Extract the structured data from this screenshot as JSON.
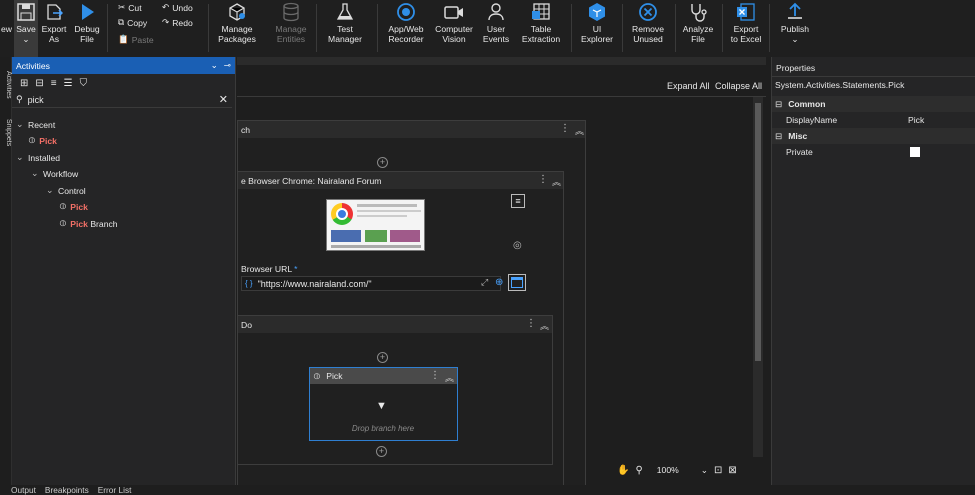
{
  "ribbon": {
    "new_label": "ew",
    "save_label": "Save",
    "export_as_label": "Export\nAs",
    "debug_file_label": "Debug\nFile",
    "cut_label": "Cut",
    "copy_label": "Copy",
    "paste_label": "Paste",
    "undo_label": "Undo",
    "redo_label": "Redo",
    "manage_packages_label": "Manage\nPackages",
    "manage_entities_label": "Manage\nEntities",
    "test_manager_label": "Test\nManager",
    "recorder_label": "App/Web\nRecorder",
    "computer_vision_label": "Computer\nVision",
    "user_events_label": "User\nEvents",
    "table_extraction_label": "Table\nExtraction",
    "ui_explorer_label": "UI\nExplorer",
    "remove_unused_label": "Remove\nUnused",
    "analyze_file_label": "Analyze\nFile",
    "export_excel_label": "Export\nto Excel",
    "publish_label": "Publish"
  },
  "left_strip": {
    "tab1": "Activities",
    "tab2": "Snippets"
  },
  "activities": {
    "title": "Activities",
    "search_value": "pick",
    "tree": {
      "recent": "Recent",
      "recent_pick": "Pick",
      "installed": "Installed",
      "workflow": "Workflow",
      "control": "Control",
      "control_pick": "Pick",
      "pick_branch_hl": "Pick",
      "pick_branch_rest": " Branch"
    }
  },
  "designer": {
    "expand_all": "Expand All",
    "collapse_all": "Collapse All",
    "outer_title": "ch",
    "browser_title": "e Browser Chrome: Nairaland Forum",
    "browser_url_label": "Browser URL",
    "required_mark": "*",
    "url_value": "\"https://www.nairaland.com/\"",
    "url_prefix": "{ }",
    "do_title": "Do",
    "pick_title": "Pick",
    "drop_branch": "Drop branch here",
    "zoom": "100%"
  },
  "properties": {
    "title": "Properties",
    "type": "System.Activities.Statements.Pick",
    "common_label": "Common",
    "display_name_label": "DisplayName",
    "display_name_value": "Pick",
    "misc_label": "Misc",
    "private_label": "Private"
  },
  "bottom": {
    "output": "Output",
    "breakpoints": "Breakpoints",
    "error_list": "Error List"
  },
  "colors": {
    "accent": "#1a5fb4",
    "highlight": "#f47067",
    "pick_border": "#2f7fd1"
  }
}
